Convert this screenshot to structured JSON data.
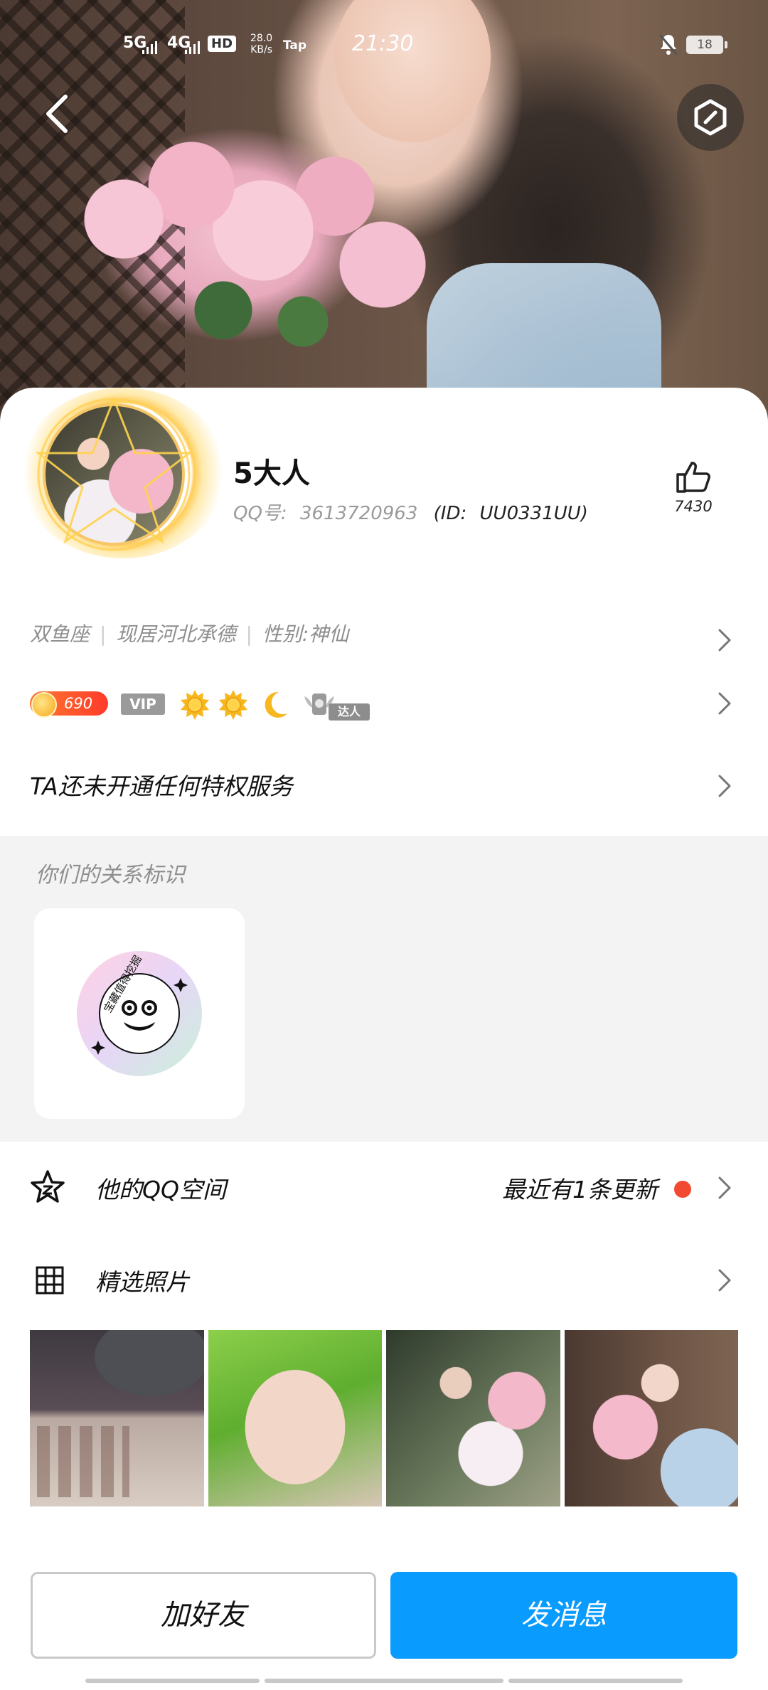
{
  "status_bar": {
    "signal_1": "5G",
    "signal_2": "4G",
    "hd": "HD",
    "speed_value": "28.0",
    "speed_unit": "KB/s",
    "app_label": "Tap",
    "time": "21:30",
    "battery": "18"
  },
  "profile": {
    "nickname": "5大人",
    "qq_label": "QQ号:",
    "qq_number": "3613720963",
    "id_label": "(ID:",
    "id_value": "UU0331UU)",
    "like_count": "7430"
  },
  "info": {
    "zodiac": "双鱼座",
    "location": "现居河北承德",
    "gender": "性别:神仙"
  },
  "badges": {
    "level": "690",
    "vip": "VIP",
    "daren": "达人"
  },
  "privilege_text": "TA还未开通任何特权服务",
  "relationship": {
    "title": "你们的关系标识",
    "badge_text": "宝藏值得挖掘"
  },
  "qzone": {
    "label": "他的QQ空间",
    "update": "最近有1条更新"
  },
  "photos": {
    "label": "精选照片"
  },
  "actions": {
    "add_friend": "加好友",
    "send_message": "发消息"
  },
  "colors": {
    "accent_blue": "#0a9bff",
    "red_dot": "#f24a31",
    "level_badge": "#ff4f2c"
  },
  "icons": [
    "back-arrow-icon",
    "hexagon-menu-icon",
    "thumbs-up-icon",
    "chevron-right-icon",
    "sun-icon",
    "moon-icon",
    "star-icon",
    "grid-icon",
    "bell-off-icon"
  ]
}
